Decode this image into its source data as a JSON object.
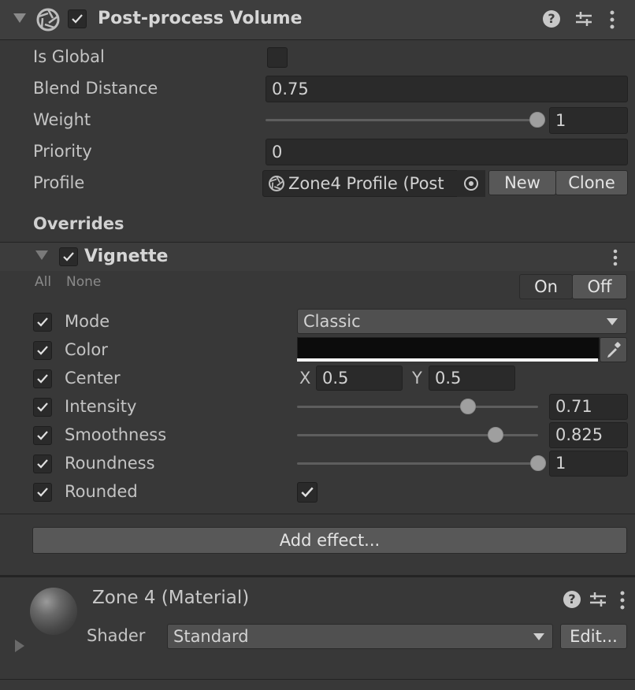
{
  "volume": {
    "title": "Post-process Volume",
    "enabled": true,
    "fields": {
      "is_global_label": "Is Global",
      "is_global": false,
      "blend_distance_label": "Blend Distance",
      "blend_distance": "0.75",
      "weight_label": "Weight",
      "weight": "1",
      "weight_fraction": 1.0,
      "priority_label": "Priority",
      "priority": "0",
      "profile_label": "Profile",
      "profile_value": "Zone4 Profile (Post",
      "new_label": "New",
      "clone_label": "Clone"
    },
    "overrides_label": "Overrides"
  },
  "vignette": {
    "title": "Vignette",
    "enabled": true,
    "all_label": "All",
    "none_label": "None",
    "on_label": "On",
    "off_label": "Off",
    "mode_label": "Mode",
    "mode_value": "Classic",
    "color_label": "Color",
    "color_value": "#0c0c0c",
    "center_label": "Center",
    "center_x_label": "X",
    "center_x": "0.5",
    "center_y_label": "Y",
    "center_y": "0.5",
    "intensity_label": "Intensity",
    "intensity": "0.71",
    "intensity_fraction": 0.71,
    "smoothness_label": "Smoothness",
    "smoothness": "0.825",
    "smoothness_fraction": 0.825,
    "roundness_label": "Roundness",
    "roundness": "1",
    "roundness_fraction": 1.0,
    "rounded_label": "Rounded",
    "rounded": true
  },
  "add_effect_label": "Add effect...",
  "material": {
    "title": "Zone 4 (Material)",
    "shader_label": "Shader",
    "shader_value": "Standard",
    "edit_label": "Edit..."
  },
  "icons": {
    "help": "help-icon",
    "presets": "presets-icon",
    "menu": "kebab-menu-icon",
    "aperture": "aperture-icon",
    "eyedropper": "eyedropper-icon"
  },
  "colors": {
    "background": "#383838",
    "header": "#3e3e3e",
    "field": "#2a2a2a",
    "button": "#585858"
  }
}
